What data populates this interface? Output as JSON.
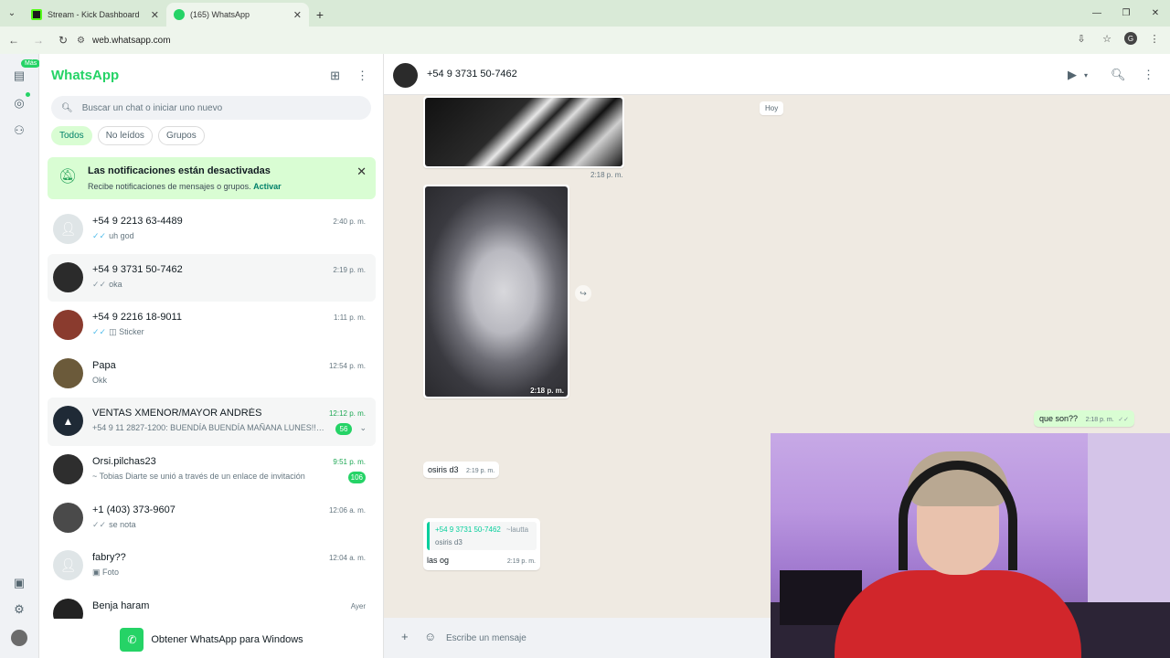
{
  "browser": {
    "tabs": [
      {
        "title": "Stream - Kick Dashboard",
        "favicon": "kick-icon",
        "active": false
      },
      {
        "title": "(165) WhatsApp",
        "favicon": "whatsapp-icon",
        "active": true
      }
    ],
    "url": "web.whatsapp.com",
    "profile_initial": "G"
  },
  "rail": {
    "badge": "Más"
  },
  "sidebar": {
    "brand": "WhatsApp",
    "search_placeholder": "Buscar un chat o iniciar uno nuevo",
    "filters": [
      "Todos",
      "No leídos",
      "Grupos"
    ],
    "notification": {
      "title": "Las notificaciones están desactivadas",
      "subtitle": "Recibe notificaciones de mensajes o grupos.",
      "action": "Activar"
    },
    "chats": [
      {
        "name": "+54 9 2213 63-4489",
        "time": "2:40 p. m.",
        "preview": "uh god",
        "ticks": "blue",
        "unread": ""
      },
      {
        "name": "+54 9 3731 50-7462",
        "time": "2:19 p. m.",
        "preview": "oka",
        "ticks": "gray",
        "unread": ""
      },
      {
        "name": "+54 9 2216 18-9011",
        "time": "1:11 p. m.",
        "preview": "Sticker",
        "ticks": "blue",
        "unread": ""
      },
      {
        "name": "Papa",
        "time": "12:54 p. m.",
        "preview": "Okk",
        "ticks": "",
        "unread": ""
      },
      {
        "name": "VENTAS XMENOR/MAYOR ANDRÉS",
        "time": "12:12 p. m.",
        "preview": "+54 9 11 2827-1200: BUENDÍA BUENDÍA MAÑANA LUNES!!! ...",
        "ticks": "",
        "unread": "56"
      },
      {
        "name": "Orsi.pilchas23",
        "time": "9:51 p. m.",
        "preview": "~ Tobias Diarte se unió a través de un enlace de invitación",
        "ticks": "",
        "unread": "106"
      },
      {
        "name": "+1 (403) 373-9607",
        "time": "12:06 a. m.",
        "preview": "se nota",
        "ticks": "gray",
        "unread": ""
      },
      {
        "name": "fabry??",
        "time": "12:04 a. m.",
        "preview": "Foto",
        "ticks": "",
        "unread": ""
      },
      {
        "name": "Benja haram",
        "time": "Ayer",
        "preview": "",
        "ticks": "",
        "unread": ""
      }
    ],
    "get_app": "Obtener WhatsApp para Windows"
  },
  "conversation": {
    "contact": "+54 9 3731 50-7462",
    "day_label": "Hoy",
    "image1_time": "2:18 p. m.",
    "image2_time": "2:18 p. m.",
    "out_msg": {
      "text": "que son??",
      "time": "2:18 p. m."
    },
    "in_msg1": {
      "text": "osiris d3",
      "time": "2:19 p. m."
    },
    "reply": {
      "quote_author": "+54 9 3731 50-7462",
      "quote_alias": "~lautta",
      "quote_text": "osiris d3",
      "text": "las og",
      "time": "2:19 p. m."
    },
    "composer_placeholder": "Escribe un mensaje"
  },
  "colors": {
    "accent": "#25d366",
    "chip_active_bg": "#d9fdd3",
    "chat_bg": "#efeae2"
  }
}
